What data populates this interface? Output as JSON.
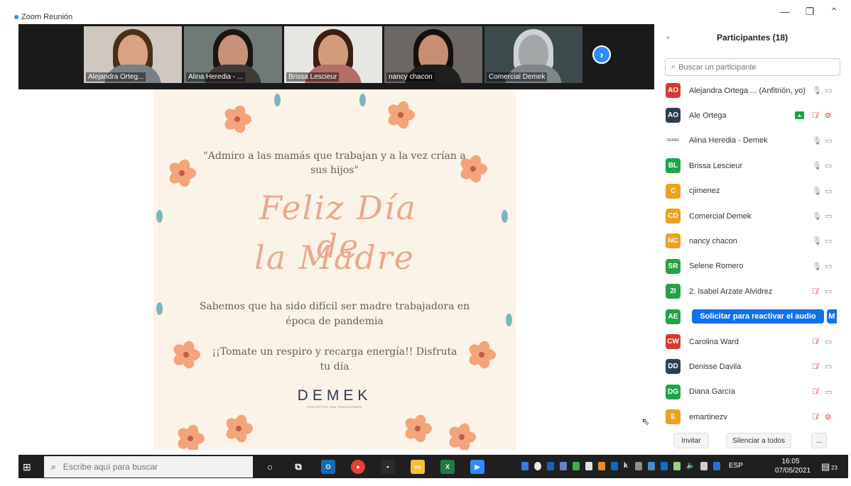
{
  "window": {
    "title": "Zoom Reunión",
    "minimize": "—",
    "restore": "❐",
    "collapse": "⌃"
  },
  "videos": [
    {
      "name": "Alejandra Orteg...",
      "bg": "#cfc8c0",
      "hair": "#4a2e1c",
      "face": "#d9a383",
      "body": "#7a7f86"
    },
    {
      "name": "Alina Heredia - ...",
      "bg": "#6f7a76",
      "hair": "#1b1512",
      "face": "#c99278",
      "body": "#3f3a36"
    },
    {
      "name": "Brissa Lescieur",
      "bg": "#e8e6e2",
      "hair": "#3a1f12",
      "face": "#d39c7d",
      "body": "#b26e67"
    },
    {
      "name": "nancy chacon",
      "bg": "#6b6763",
      "hair": "#16100c",
      "face": "#c68e72",
      "body": "#1e1e1e"
    },
    {
      "name": "Comercial Demek",
      "bg": "#3d4a4c",
      "hair": "#cdd3d4",
      "face": "#a3a7a8",
      "body": "#7d8789"
    }
  ],
  "share": {
    "quote": "\"Admiro a las mamás que trabajan y a la vez crían a sus hijos\"",
    "script_line1": "Feliz Día de",
    "script_line2": "la Madre",
    "message1": "Sabemos que ha sido difícil ser madre trabajadora en época de pandemia",
    "message2": "¡¡Tomate un respiro y recarga energía!! Disfruta tu día",
    "brand": "DEMEK",
    "brand_tagline": "PROYECTOS QUE TRASCIENDEN"
  },
  "participants_panel": {
    "title": "Participantes (18)",
    "search_placeholder": "Buscar un participante",
    "reactivate_label": "Solicitar para reactivar el audio",
    "reactivate_more": "M",
    "invite": "Invitar",
    "mute_all": "Silenciar a todos",
    "more": "...",
    "participants": [
      {
        "initials": "AO",
        "name": "Alejandra Ortega ... (Anfitrión, yo)",
        "color": "#d43b2f",
        "mic_muted": false,
        "cam_muted": false,
        "sharing": false
      },
      {
        "initials": "AO",
        "name": "Ale Ortega",
        "color": "#2d3e50",
        "mic_muted": true,
        "cam_muted": true,
        "sharing": true
      },
      {
        "initials": "DEMEK",
        "name": "Alina Heredia - Demek",
        "color": "#ffffff",
        "mic_muted": false,
        "cam_muted": false,
        "sharing": false
      },
      {
        "initials": "BL",
        "name": "Brissa Lescieur",
        "color": "#22a348",
        "mic_muted": false,
        "cam_muted": false,
        "sharing": false
      },
      {
        "initials": "C",
        "name": "cjimenez",
        "color": "#f0a119",
        "mic_muted": false,
        "cam_muted": false,
        "sharing": false
      },
      {
        "initials": "CD",
        "name": "Comercial Demek",
        "color": "#f0a119",
        "mic_muted": false,
        "cam_muted": false,
        "sharing": false
      },
      {
        "initials": "NC",
        "name": "nancy chacon",
        "color": "#f0a119",
        "mic_muted": false,
        "cam_muted": false,
        "sharing": false
      },
      {
        "initials": "SR",
        "name": "Selene Romero",
        "color": "#22a348",
        "mic_muted": false,
        "cam_muted": false,
        "sharing": false
      },
      {
        "initials": "2I",
        "name": "2. Isabel Arzate Alvidrez",
        "color": "#22a348",
        "mic_muted": true,
        "cam_muted": false,
        "sharing": false
      },
      {
        "initials": "AE",
        "name": "",
        "color": "#22a348",
        "mic_muted": false,
        "cam_muted": false,
        "sharing": false,
        "reactivate": true
      },
      {
        "initials": "CW",
        "name": "Carolina Ward",
        "color": "#d43b2f",
        "mic_muted": true,
        "cam_muted": false,
        "sharing": false
      },
      {
        "initials": "DD",
        "name": "Denisse Davila",
        "color": "#2d3e50",
        "mic_muted": true,
        "cam_muted": false,
        "sharing": false
      },
      {
        "initials": "DG",
        "name": "Diana García",
        "color": "#22a348",
        "mic_muted": true,
        "cam_muted": false,
        "sharing": false
      },
      {
        "initials": "E",
        "name": "emartinezv",
        "color": "#f0a119",
        "mic_muted": true,
        "cam_muted": true,
        "sharing": false
      }
    ]
  },
  "taskbar": {
    "search_placeholder": "Escribe aquí para buscar",
    "language": "ESP",
    "time": "16:05",
    "date": "07/05/2021",
    "notifications": "23"
  },
  "colors": {
    "accent": "#2d8cff",
    "muted_red": "#e02828",
    "card_bg": "#fbf3e8",
    "flower": "#f4a47a",
    "leaf": "#7cb4c2"
  }
}
